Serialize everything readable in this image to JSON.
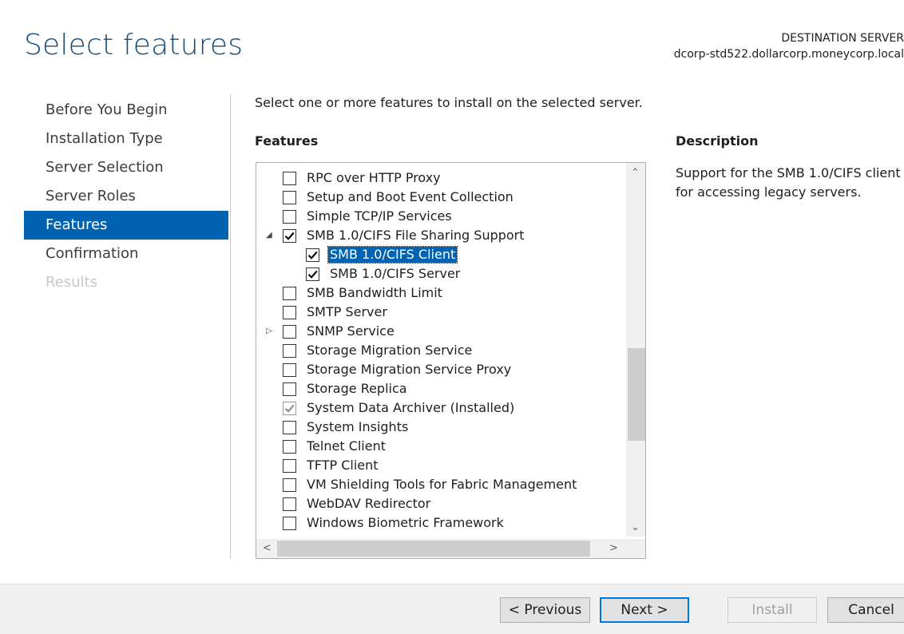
{
  "page": {
    "title": "Select features"
  },
  "destination": {
    "label": "DESTINATION SERVER",
    "server": "dcorp-std522.dollarcorp.moneycorp.local"
  },
  "nav": {
    "items": [
      {
        "label": "Before You Begin",
        "state": "normal"
      },
      {
        "label": "Installation Type",
        "state": "normal"
      },
      {
        "label": "Server Selection",
        "state": "normal"
      },
      {
        "label": "Server Roles",
        "state": "normal"
      },
      {
        "label": "Features",
        "state": "active"
      },
      {
        "label": "Confirmation",
        "state": "normal"
      },
      {
        "label": "Results",
        "state": "disabled"
      }
    ]
  },
  "main": {
    "intro": "Select one or more features to install on the selected server.",
    "features_header": "Features",
    "description_header": "Description",
    "description": "Support for the SMB 1.0/CIFS client for accessing legacy servers."
  },
  "features": [
    {
      "label": "RPC over HTTP Proxy",
      "checked": false
    },
    {
      "label": "Setup and Boot Event Collection",
      "checked": false
    },
    {
      "label": "Simple TCP/IP Services",
      "checked": false
    },
    {
      "label": "SMB 1.0/CIFS File Sharing Support",
      "checked": true,
      "expander": "expanded"
    },
    {
      "label": "SMB 1.0/CIFS Client",
      "checked": true,
      "child": true,
      "selected": true
    },
    {
      "label": "SMB 1.0/CIFS Server",
      "checked": true,
      "child": true
    },
    {
      "label": "SMB Bandwidth Limit",
      "checked": false
    },
    {
      "label": "SMTP Server",
      "checked": false
    },
    {
      "label": "SNMP Service",
      "checked": false,
      "expander": "collapsed"
    },
    {
      "label": "Storage Migration Service",
      "checked": false
    },
    {
      "label": "Storage Migration Service Proxy",
      "checked": false
    },
    {
      "label": "Storage Replica",
      "checked": false
    },
    {
      "label": "System Data Archiver (Installed)",
      "checked": true,
      "disabled": true
    },
    {
      "label": "System Insights",
      "checked": false
    },
    {
      "label": "Telnet Client",
      "checked": false
    },
    {
      "label": "TFTP Client",
      "checked": false
    },
    {
      "label": "VM Shielding Tools for Fabric Management",
      "checked": false
    },
    {
      "label": "WebDAV Redirector",
      "checked": false
    },
    {
      "label": "Windows Biometric Framework",
      "checked": false
    }
  ],
  "footer": {
    "previous": "< Previous",
    "next": "Next >",
    "install": "Install",
    "cancel": "Cancel"
  }
}
